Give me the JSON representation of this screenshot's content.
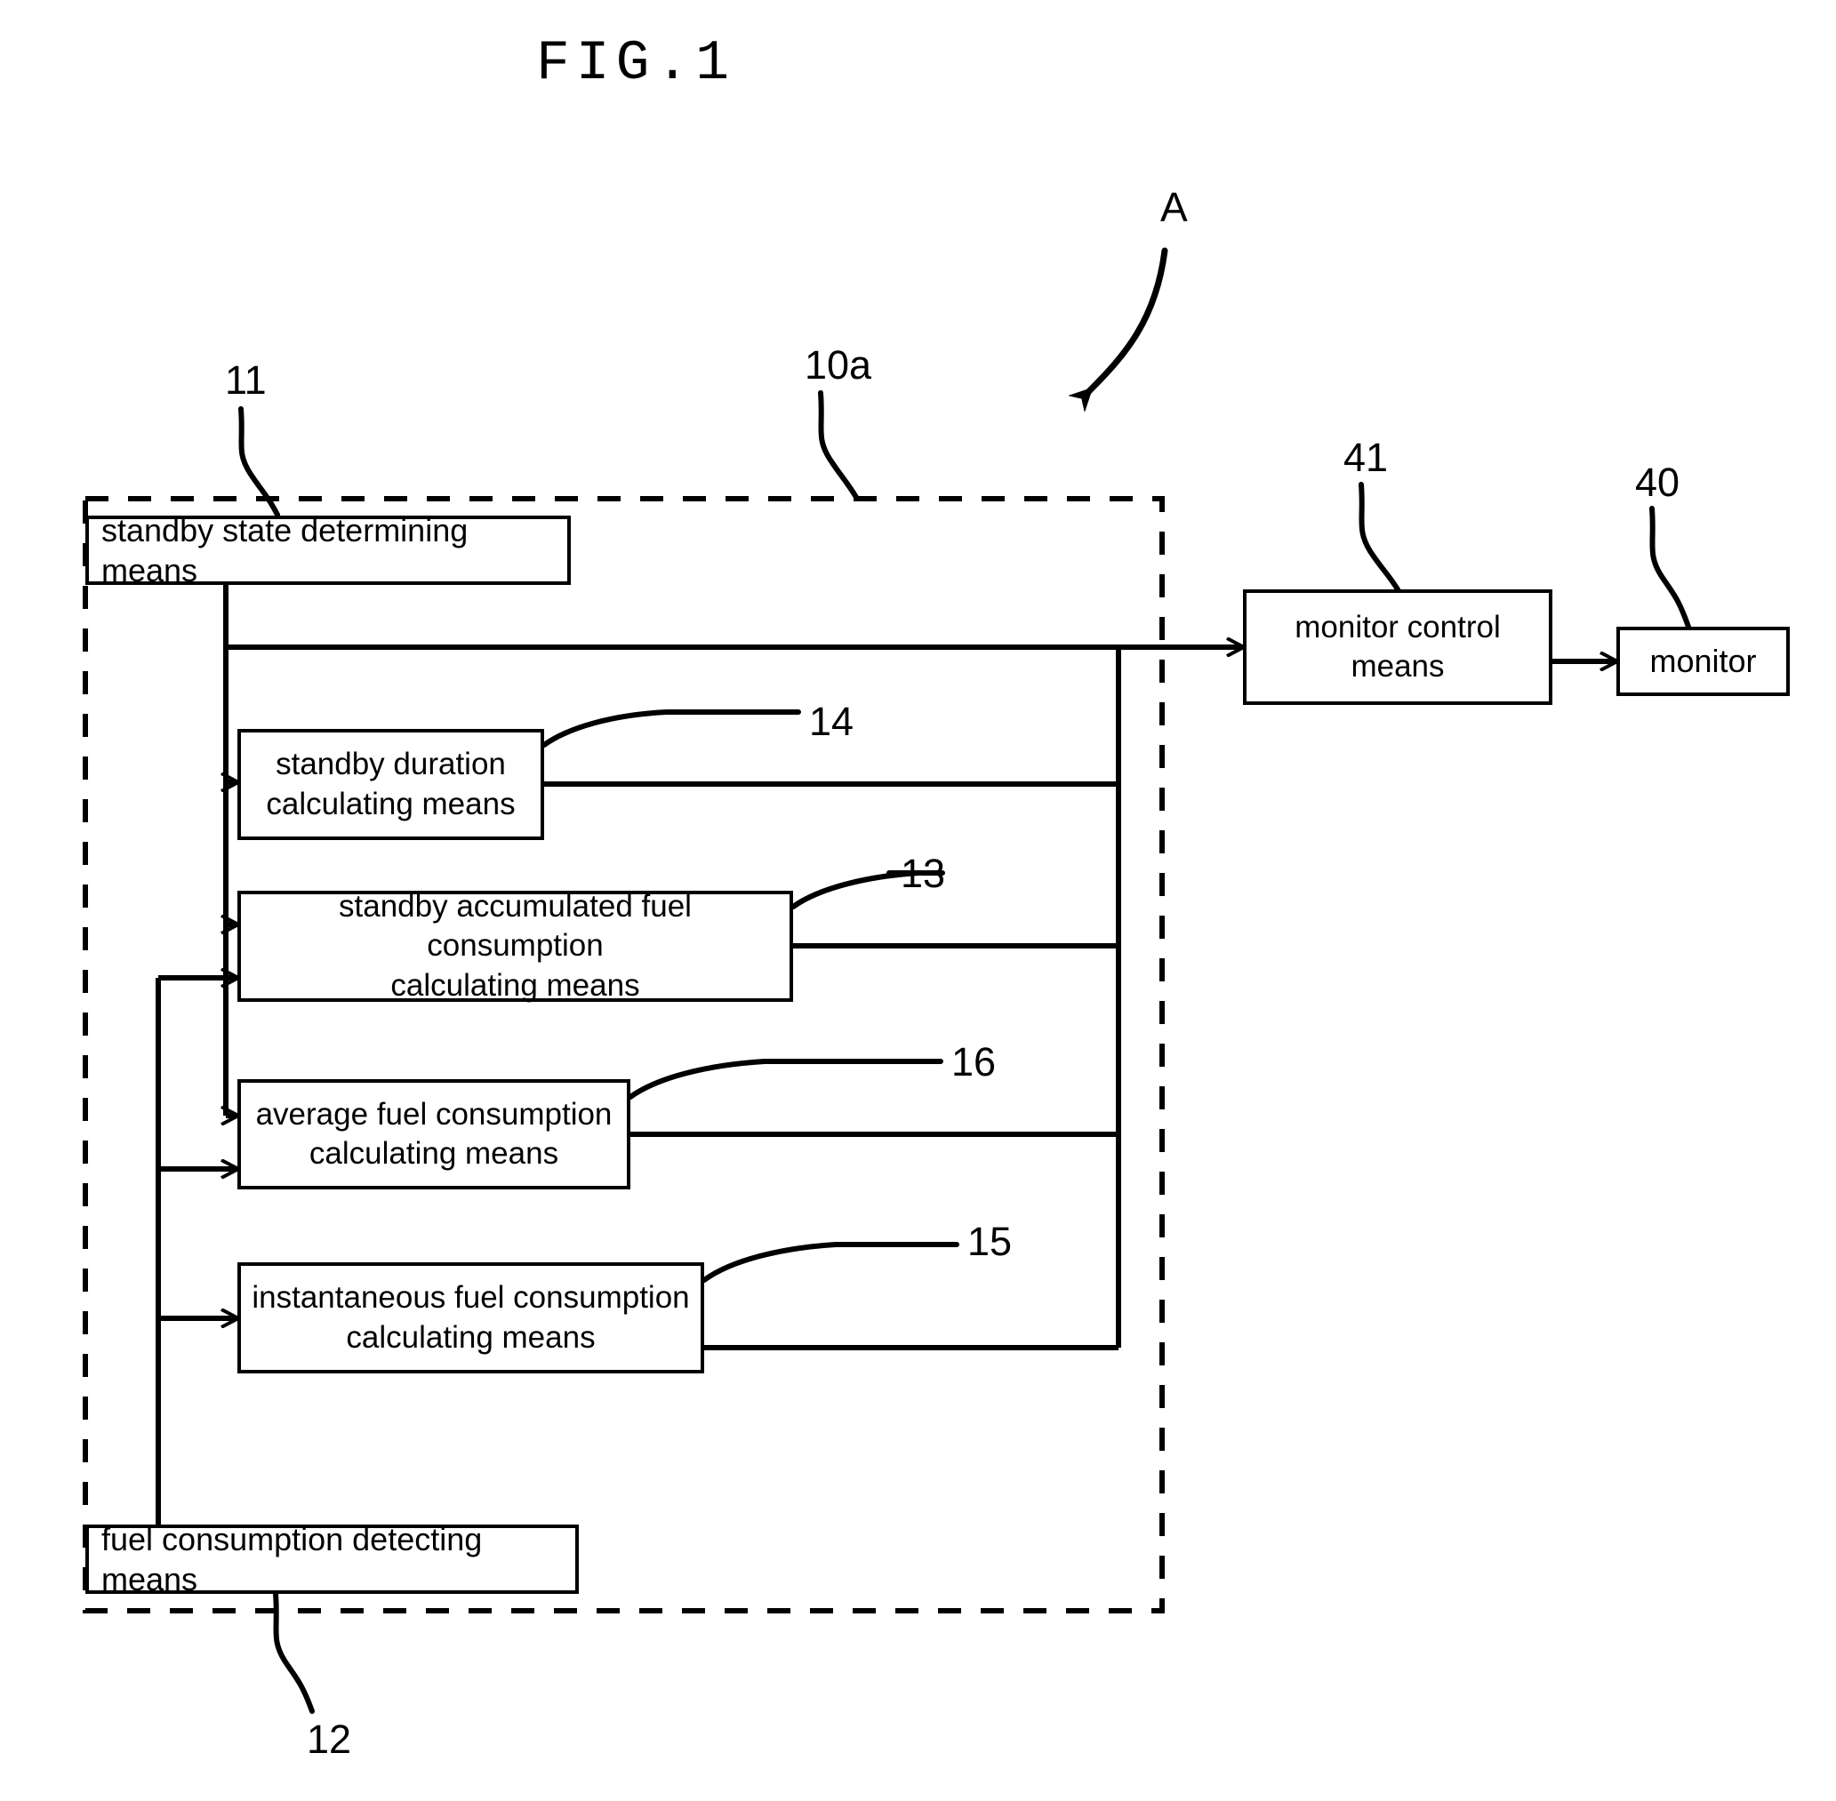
{
  "figure": {
    "title": "FIG.1",
    "system_marker": "A"
  },
  "boxes": {
    "standby_state": "standby state determining means",
    "standby_duration_line1": "standby duration",
    "standby_duration_line2": "calculating means",
    "standby_accumulated_line1": "standby accumulated fuel consumption",
    "standby_accumulated_line2": "calculating means",
    "average_fuel_line1": "average fuel consumption",
    "average_fuel_line2": "calculating means",
    "instantaneous_line1": "instantaneous fuel consumption",
    "instantaneous_line2": "calculating means",
    "fuel_detect": "fuel consumption detecting means",
    "monitor_control_line1": "monitor control",
    "monitor_control_line2": "means",
    "monitor": "monitor"
  },
  "reference_numerals": {
    "standby_state": "11",
    "controller_unit": "10a",
    "fuel_detect": "12",
    "standby_accumulated": "13",
    "standby_duration": "14",
    "instantaneous": "15",
    "average_fuel": "16",
    "monitor": "40",
    "monitor_control": "41"
  },
  "colors": {
    "stroke": "#000000",
    "background": "#ffffff"
  }
}
